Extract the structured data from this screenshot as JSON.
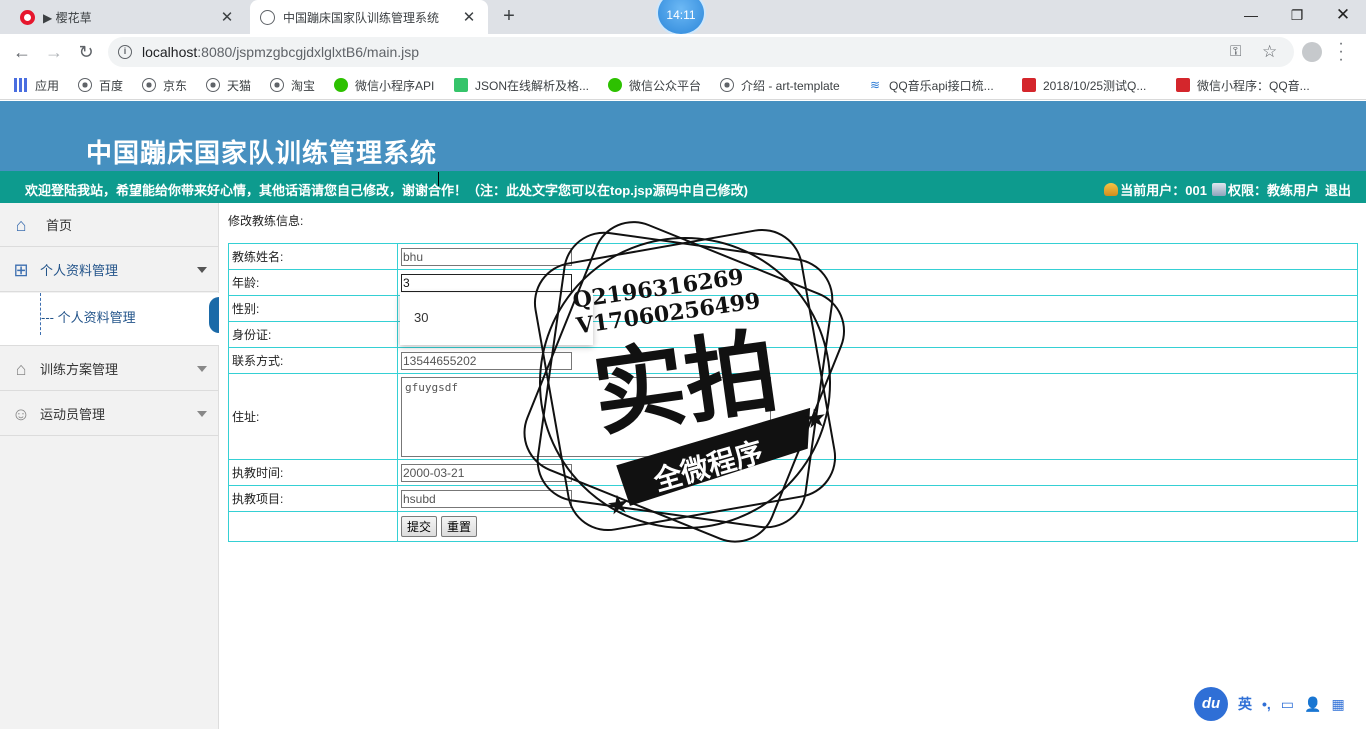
{
  "browser": {
    "tabs": [
      {
        "title": "▶ 樱花草",
        "close": "✕"
      },
      {
        "title": "中国蹦床国家队训练管理系统",
        "close": "✕"
      }
    ],
    "new_tab": "+",
    "clock": "14:11",
    "window_controls": {
      "minimize": "—",
      "maximize": "❐",
      "close": "✕"
    },
    "url_host": "localhost",
    "url_rest": ":8080/jspmzgbcgjdxlglxtB6/main.jsp",
    "bookmarks": [
      {
        "label": "应用",
        "icon": "apps-icon"
      },
      {
        "label": "百度",
        "icon": "globe-icon"
      },
      {
        "label": "京东",
        "icon": "globe-icon"
      },
      {
        "label": "天猫",
        "icon": "globe-icon"
      },
      {
        "label": "淘宝",
        "icon": "globe-icon"
      },
      {
        "label": "微信小程序API",
        "icon": "wechat-icon"
      },
      {
        "label": "JSON在线解析及格...",
        "icon": "json-icon"
      },
      {
        "label": "微信公众平台",
        "icon": "wechat-icon"
      },
      {
        "label": "介绍 - art-template",
        "icon": "globe-icon"
      },
      {
        "label": "QQ音乐api接口梳...",
        "icon": "qq-icon"
      },
      {
        "label": "2018/10/25测试Q...",
        "icon": "csdn-icon"
      },
      {
        "label": "微信小程序：QQ音...",
        "icon": "csdn-icon"
      }
    ]
  },
  "header": {
    "title": "中国蹦床国家队训练管理系统",
    "notice": "欢迎登陆我站，希望能给你带来好心情，其他话语请您自己修改，谢谢合作！（注：此处文字您可以在top.jsp源码中自己修改)",
    "current_user_label": "当前用户：001",
    "permission_label": "权限：教练用户",
    "logout": "退出"
  },
  "sidebar": {
    "items": [
      {
        "label": "首页",
        "icon": "home-icon"
      },
      {
        "label": "个人资料管理",
        "icon": "grid-icon"
      },
      {
        "label": "训练方案管理",
        "icon": "house-icon"
      },
      {
        "label": "运动员管理",
        "icon": "user-icon"
      }
    ],
    "sub_item": "--- 个人资料管理"
  },
  "form": {
    "caption": "修改教练信息:",
    "fields": {
      "name": {
        "label": "教练姓名:",
        "value": "bhu"
      },
      "age": {
        "label": "年龄:",
        "value": "3"
      },
      "gender": {
        "label": "性别:"
      },
      "idcard": {
        "label": "身份证:"
      },
      "phone": {
        "label": "联系方式:",
        "value": "13544655202"
      },
      "address": {
        "label": "住址:",
        "value": "gfuygsdf"
      },
      "date": {
        "label": "执教时间:",
        "value": "2000-03-21"
      },
      "project": {
        "label": "执教项目:",
        "value": "hsubd"
      }
    },
    "submit": "提交",
    "reset": "重置",
    "autocomplete_option": "30"
  },
  "watermark": {
    "line1": "Q2196316269",
    "line2": "V17060256499",
    "big": "实拍",
    "ribbon": "全微程序"
  },
  "ime": {
    "logo": "du",
    "lang": "英",
    "punct": "•,",
    "items": [
      "▭",
      "👤",
      "▦"
    ]
  }
}
